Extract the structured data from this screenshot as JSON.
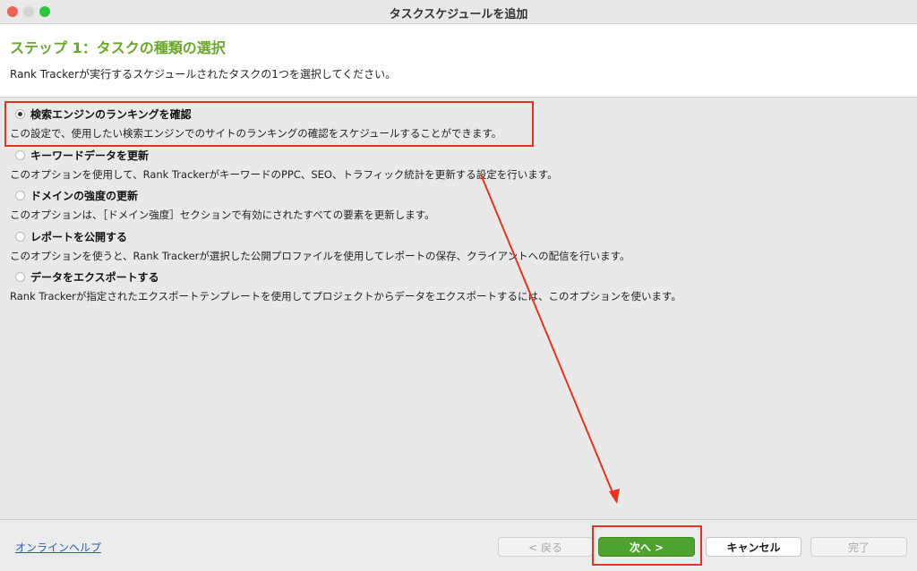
{
  "window": {
    "title": "タスクスケジュールを追加"
  },
  "header": {
    "step_title": "ステップ 1：タスクの種類の選択",
    "description": "Rank Trackerが実行するスケジュールされたタスクの1つを選択してください。"
  },
  "options": [
    {
      "label": "検索エンジンのランキングを確認",
      "description": "この設定で、使用したい検索エンジンでのサイトのランキングの確認をスケジュールすることができます。",
      "selected": true
    },
    {
      "label": "キーワードデータを更新",
      "description": "このオプションを使用して、Rank TrackerがキーワードのPPC、SEO、トラフィック統計を更新する設定を行います。",
      "selected": false
    },
    {
      "label": "ドメインの強度の更新",
      "description": "このオプションは、［ドメイン強度］セクションで有効にされたすべての要素を更新します。",
      "selected": false
    },
    {
      "label": "レポートを公開する",
      "description": "このオプションを使うと、Rank Trackerが選択した公開プロファイルを使用してレポートの保存、クライアントへの配信を行います。",
      "selected": false
    },
    {
      "label": "データをエクスポートする",
      "description": "Rank Trackerが指定されたエクスポートテンプレートを使用してプロジェクトからデータをエクスポートするには、このオプションを使います。",
      "selected": false
    }
  ],
  "footer": {
    "help_link": "オンラインヘルプ",
    "back_label": "< 戻る",
    "next_label": "次へ >",
    "cancel_label": "キャンセル",
    "finish_label": "完了"
  },
  "colors": {
    "accent_green": "#6aa827",
    "next_button": "#4ea22f",
    "annotation_red": "#e8321c"
  }
}
